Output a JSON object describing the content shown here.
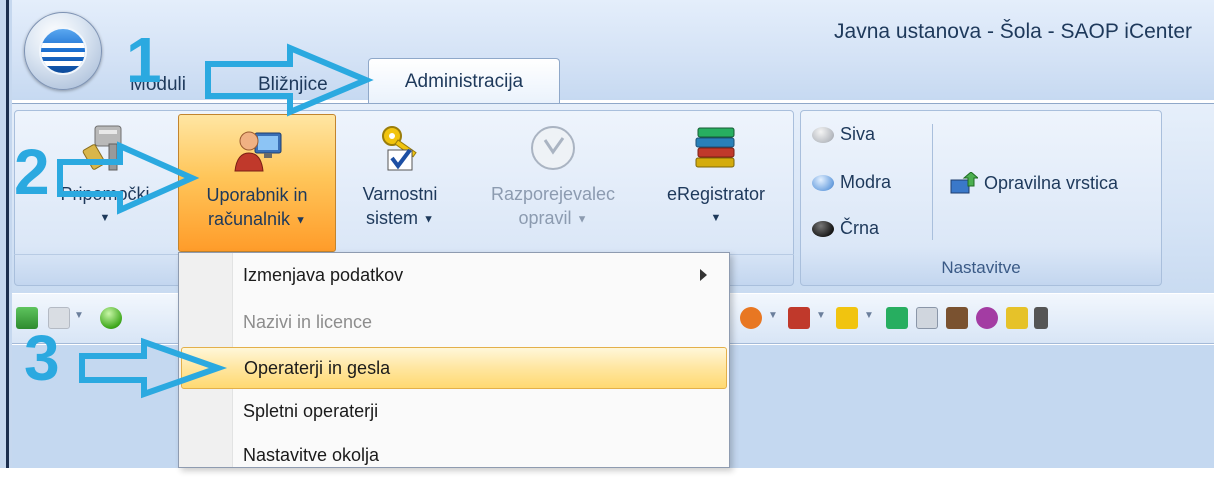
{
  "window": {
    "title": "Javna ustanova - Šola - SAOP iCenter"
  },
  "tabs": [
    {
      "label": "Moduli"
    },
    {
      "label": "Bližnjice"
    },
    {
      "label": "Administracija",
      "active": true
    }
  ],
  "ribbon": {
    "group_main": {
      "buttons": [
        {
          "line1": "Pripomočki",
          "line2": "",
          "dropdown": true,
          "icon": "tools-icon",
          "enabled": true
        },
        {
          "line1": "Uporabnik in",
          "line2": "računalnik",
          "dropdown": true,
          "icon": "user-computer-icon",
          "enabled": true,
          "pressed": true
        },
        {
          "line1": "Varnostni",
          "line2": "sistem",
          "dropdown": true,
          "icon": "keys-icon",
          "enabled": true
        },
        {
          "line1": "Razporejevalec",
          "line2": "opravil",
          "dropdown": true,
          "icon": "scheduler-clock-icon",
          "enabled": false
        },
        {
          "line1": "eRegistrator",
          "line2": "",
          "dropdown": true,
          "icon": "books-stack-icon",
          "enabled": true
        }
      ]
    },
    "group_nastavitve": {
      "caption": "Nastavitve",
      "themes": [
        {
          "label": "Siva",
          "color": "#b8bcc2"
        },
        {
          "label": "Modra",
          "color": "#6fa3e0"
        },
        {
          "label": "Črna",
          "color": "#1a1a1a"
        }
      ],
      "taskbar_button": {
        "label": "Opravilna vrstica",
        "icon": "taskbar-upload-icon"
      }
    }
  },
  "dropdown_menu": {
    "items": [
      {
        "label": "Izmenjava podatkov",
        "enabled": true,
        "submenu": true,
        "highlighted": false
      },
      {
        "label": "Nazivi in licence",
        "enabled": false,
        "submenu": false,
        "highlighted": false
      },
      {
        "label": "Operaterji in gesla",
        "enabled": true,
        "submenu": false,
        "highlighted": true
      },
      {
        "label": "Spletni operaterji",
        "enabled": true,
        "submenu": false,
        "highlighted": false
      },
      {
        "label": "Nastavitve okolja",
        "enabled": true,
        "submenu": false,
        "highlighted": false
      }
    ]
  },
  "annotations": {
    "step1": "1",
    "step2": "2",
    "step3": "3",
    "arrow_color": "#2ba9e0"
  }
}
